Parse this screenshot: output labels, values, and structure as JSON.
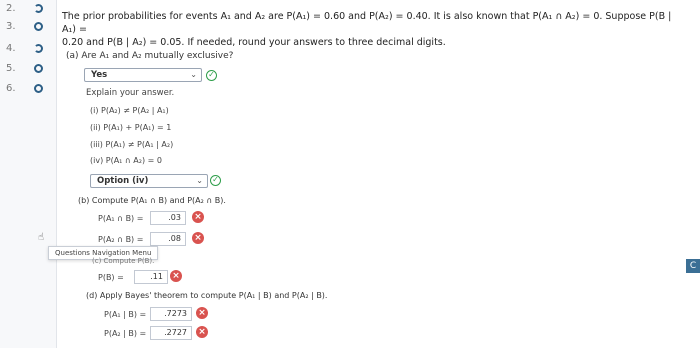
{
  "nav": {
    "items": [
      {
        "num": "2.",
        "state": "half"
      },
      {
        "num": "3.",
        "state": "open"
      },
      {
        "num": "4.",
        "state": "half"
      },
      {
        "num": "5.",
        "state": "open"
      },
      {
        "num": "6.",
        "state": "open"
      }
    ],
    "popup_label": "Questions Navigation Menu"
  },
  "problem": {
    "text_line1": "The prior probabilities for events A₁ and A₂ are P(A₁) = 0.60 and P(A₂) = 0.40. It is also known that P(A₁ ∩ A₂) = 0. Suppose P(B | A₁) =",
    "text_line2": "0.20 and P(B | A₂) = 0.05. If needed, round your answers to three decimal digits."
  },
  "part_a": {
    "question": "(a) Are A₁ and A₂ mutually exclusive?",
    "select_value": "Yes",
    "explain_label": "Explain your answer.",
    "options": [
      "(i)  P(A₂) ≠ P(A₂ | A₁)",
      "(ii)  P(A₁) + P(A₁) = 1",
      "(iii)  P(A₁) ≠ P(A₁ | A₂)",
      "(iv)  P(A₁ ∩ A₂) = 0"
    ],
    "option_select_value": "Option (iv)"
  },
  "part_b": {
    "question": "(b) Compute P(A₁ ∩ B) and P(A₂ ∩ B).",
    "row1_label": "P(A₁ ∩ B) =",
    "row1_value": ".03",
    "row2_label": "P(A₂ ∩ B) =",
    "row2_value": ".08"
  },
  "part_c": {
    "partial_header": "(c) Compute P(B).",
    "row_label": "P(B) =",
    "row_value": ".11"
  },
  "part_d": {
    "question": "(d) Apply Bayes' theorem to compute P(A₁ | B) and P(A₂ | B).",
    "row1_label": "P(A₁ | B) =",
    "row1_value": ".7273",
    "row2_label": "P(A₂ | B) =",
    "row2_value": ".2727"
  },
  "colors": {
    "correct": "#2e9e4a",
    "incorrect": "#d9534f",
    "nav_accent": "#2d5f86"
  },
  "right_edge_label": "C"
}
